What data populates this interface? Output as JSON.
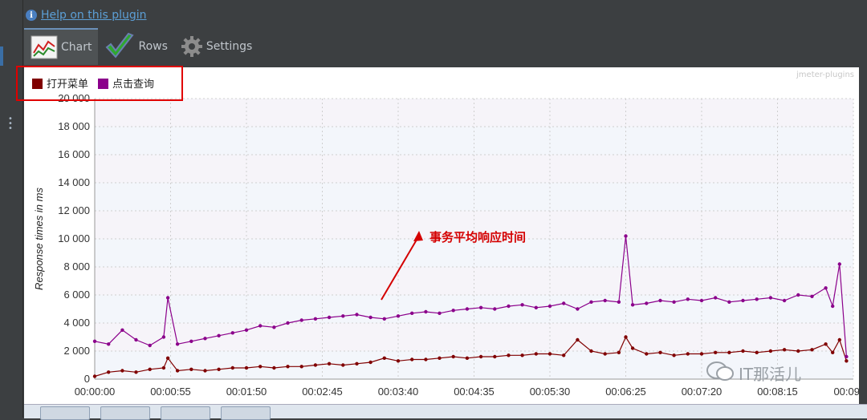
{
  "help": {
    "label": "Help on this plugin"
  },
  "tabs": [
    {
      "label": "Chart",
      "icon": "chart-icon"
    },
    {
      "label": "Rows",
      "icon": "checkmark-icon"
    },
    {
      "label": "Settings",
      "icon": "gear-icon"
    }
  ],
  "watermark_top": "jmeter-plugins",
  "watermark_bottom": "IT那活儿",
  "colors": {
    "series1": "#800000",
    "series2": "#8b008b",
    "annotation": "#d40000",
    "legend_box": "#e00000"
  },
  "chart_data": {
    "type": "line",
    "ylabel": "Response times in ms",
    "xlabel": "",
    "ylim": [
      0,
      20000
    ],
    "yticks": [
      "0",
      "2 000",
      "4 000",
      "6 000",
      "8 000",
      "10 000",
      "12 000",
      "14 000",
      "16 000",
      "18 000",
      "20 000"
    ],
    "xticks": [
      "00:00:00",
      "00:00:55",
      "00:01:50",
      "00:02:45",
      "00:03:40",
      "00:04:35",
      "00:05:30",
      "00:06:25",
      "00:07:20",
      "00:08:15",
      "00:09"
    ],
    "xlim_seconds": [
      0,
      550
    ],
    "annotation": "事务平均响应时间",
    "legend": "top-left",
    "grid": true,
    "series": [
      {
        "name": "打开菜单",
        "color": "#800000",
        "x": [
          0,
          10,
          20,
          30,
          40,
          50,
          53,
          60,
          70,
          80,
          90,
          100,
          110,
          120,
          130,
          140,
          150,
          160,
          170,
          180,
          190,
          200,
          210,
          220,
          230,
          240,
          250,
          260,
          270,
          280,
          290,
          300,
          310,
          320,
          330,
          340,
          350,
          360,
          370,
          380,
          385,
          390,
          400,
          410,
          420,
          430,
          440,
          450,
          460,
          470,
          480,
          490,
          500,
          510,
          520,
          530,
          535,
          540,
          545
        ],
        "values": [
          200,
          500,
          600,
          500,
          700,
          800,
          1500,
          600,
          700,
          600,
          700,
          800,
          800,
          900,
          800,
          900,
          900,
          1000,
          1100,
          1000,
          1100,
          1200,
          1500,
          1300,
          1400,
          1400,
          1500,
          1600,
          1500,
          1600,
          1600,
          1700,
          1700,
          1800,
          1800,
          1700,
          2800,
          2000,
          1800,
          1900,
          3000,
          2200,
          1800,
          1900,
          1700,
          1800,
          1800,
          1900,
          1900,
          2000,
          1900,
          2000,
          2100,
          2000,
          2100,
          2500,
          1900,
          2800,
          1300
        ]
      },
      {
        "name": "点击查询",
        "color": "#8b008b",
        "x": [
          0,
          10,
          20,
          30,
          40,
          50,
          53,
          60,
          70,
          80,
          90,
          100,
          110,
          120,
          130,
          140,
          150,
          160,
          170,
          180,
          190,
          200,
          210,
          220,
          230,
          240,
          250,
          260,
          270,
          280,
          290,
          300,
          310,
          320,
          330,
          340,
          350,
          360,
          370,
          380,
          385,
          390,
          400,
          410,
          420,
          430,
          440,
          450,
          460,
          470,
          480,
          490,
          500,
          510,
          520,
          530,
          535,
          540,
          545
        ],
        "values": [
          2700,
          2500,
          3500,
          2800,
          2400,
          3000,
          5800,
          2500,
          2700,
          2900,
          3100,
          3300,
          3500,
          3800,
          3700,
          4000,
          4200,
          4300,
          4400,
          4500,
          4600,
          4400,
          4300,
          4500,
          4700,
          4800,
          4700,
          4900,
          5000,
          5100,
          5000,
          5200,
          5300,
          5100,
          5200,
          5400,
          5000,
          5500,
          5600,
          5500,
          10200,
          5300,
          5400,
          5600,
          5500,
          5700,
          5600,
          5800,
          5500,
          5600,
          5700,
          5800,
          5600,
          6000,
          5900,
          6500,
          5200,
          8200,
          1600
        ]
      }
    ]
  }
}
